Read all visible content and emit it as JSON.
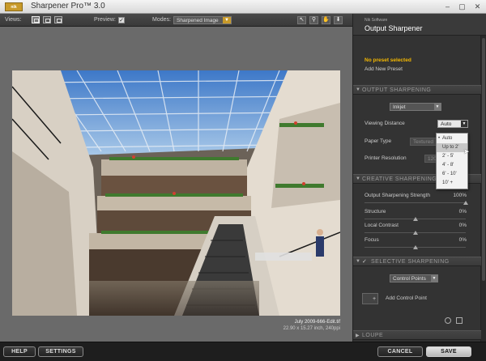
{
  "app": {
    "logo_text": "nik",
    "title": "Sharpener Pro™ 3.0"
  },
  "toolbar": {
    "views_label": "Views:",
    "preview_label": "Preview:",
    "preview_checked": true,
    "modes_label": "Modes:",
    "mode_value": "Sharpened Image",
    "icons": [
      "pointer-icon",
      "zoom-icon",
      "hand-icon",
      "eyedropper-icon"
    ]
  },
  "image": {
    "filename": "July 2009-666-Edit.tif",
    "dimensions": "22.90 x 15.27 inch, 240ppi"
  },
  "panel": {
    "vendor": "Nik Software",
    "filter_name": "Output Sharpener",
    "preset_status": "No preset selected",
    "add_preset": "Add New Preset",
    "output_section": "OUTPUT SHARPENING",
    "printer_type_value": "Inkjet",
    "viewing_distance_label": "Viewing Distance",
    "viewing_distance_value": "Auto",
    "paper_type_label": "Paper Type",
    "paper_type_value": "Textured",
    "printer_resolution_label": "Printer Resolution",
    "printer_resolution_value": "120",
    "distance_options": [
      "Auto",
      "Up to 2'",
      "2' - 5'",
      "4' - 8'",
      "6' - 10'",
      "10' +"
    ],
    "distance_selected_index": 1,
    "creative_section": "CREATIVE SHARPENING",
    "sliders": [
      {
        "label": "Output Sharpening Strength",
        "value": "100%",
        "level": 1.0
      },
      {
        "label": "Structure",
        "value": "0%",
        "level": 0.5
      },
      {
        "label": "Local Contrast",
        "value": "0%",
        "level": 0.5
      },
      {
        "label": "Focus",
        "value": "0%",
        "level": 0.5
      }
    ],
    "selective_section": "SELECTIVE SHARPENING",
    "selective_checked": true,
    "control_points_value": "Control Points",
    "add_control_point": "Add Control Point",
    "loupe_section": "LOUPE"
  },
  "footer": {
    "help": "HELP",
    "settings": "SETTINGS",
    "cancel": "CANCEL",
    "save": "SAVE"
  },
  "colors": {
    "accent": "#c89a2a",
    "preset_warning": "#f5b800"
  }
}
